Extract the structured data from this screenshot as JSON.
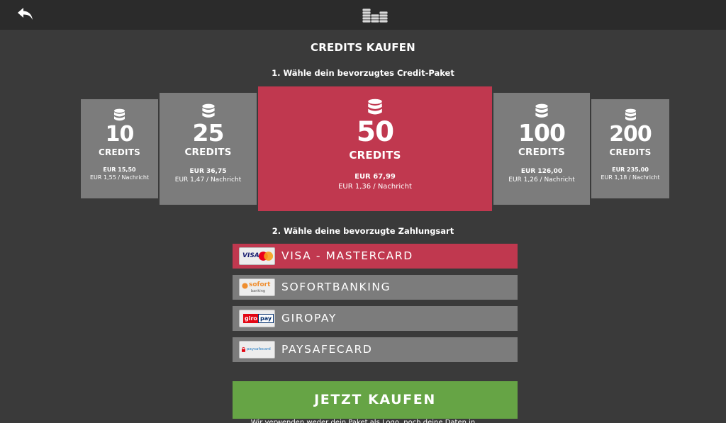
{
  "header": {
    "back_icon": "back-arrow-icon",
    "logo_icon": "coins-stack-icon"
  },
  "page": {
    "title": "CREDITS KAUFEN",
    "step1": "1. Wähle dein bevorzugtes Credit-Paket",
    "step2": "2. Wähle deine bevorzugte Zahlungsart"
  },
  "packages": [
    {
      "amount": "10",
      "unit": "CREDITS",
      "price": "EUR 15,50",
      "per_message": "EUR 1,55 / Nachricht",
      "selected": false
    },
    {
      "amount": "25",
      "unit": "CREDITS",
      "price": "EUR 36,75",
      "per_message": "EUR 1,47 / Nachricht",
      "selected": false
    },
    {
      "amount": "50",
      "unit": "CREDITS",
      "price": "EUR 67,99",
      "per_message": "EUR 1,36 / Nachricht",
      "selected": true
    },
    {
      "amount": "100",
      "unit": "CREDITS",
      "price": "EUR 126,00",
      "per_message": "EUR 1,26 / Nachricht",
      "selected": false
    },
    {
      "amount": "200",
      "unit": "CREDITS",
      "price": "EUR 235,00",
      "per_message": "EUR 1,18 / Nachricht",
      "selected": false
    }
  ],
  "payment_methods": [
    {
      "label": "VISA - MASTERCARD",
      "logo_text": "VISA",
      "selected": true
    },
    {
      "label": "SOFORTBANKING",
      "logo_text": "sofort",
      "logo_subtext": "banking",
      "selected": false
    },
    {
      "label": "GIROPAY",
      "logo_text": "giro",
      "logo_text2": "pay",
      "selected": false
    },
    {
      "label": "PAYSAFECARD",
      "logo_text": "paysafecard",
      "selected": false
    }
  ],
  "buy_button": {
    "label": "JETZT KAUFEN"
  },
  "footnote": "Wir verwenden weder dein Paket als Logo, noch deine Daten in",
  "colors": {
    "background": "#3a3a3a",
    "topbar": "#2b2b2b",
    "package_bg": "#7c7c7c",
    "accent_selected": "#c0384f",
    "buy_green": "#66a445"
  }
}
